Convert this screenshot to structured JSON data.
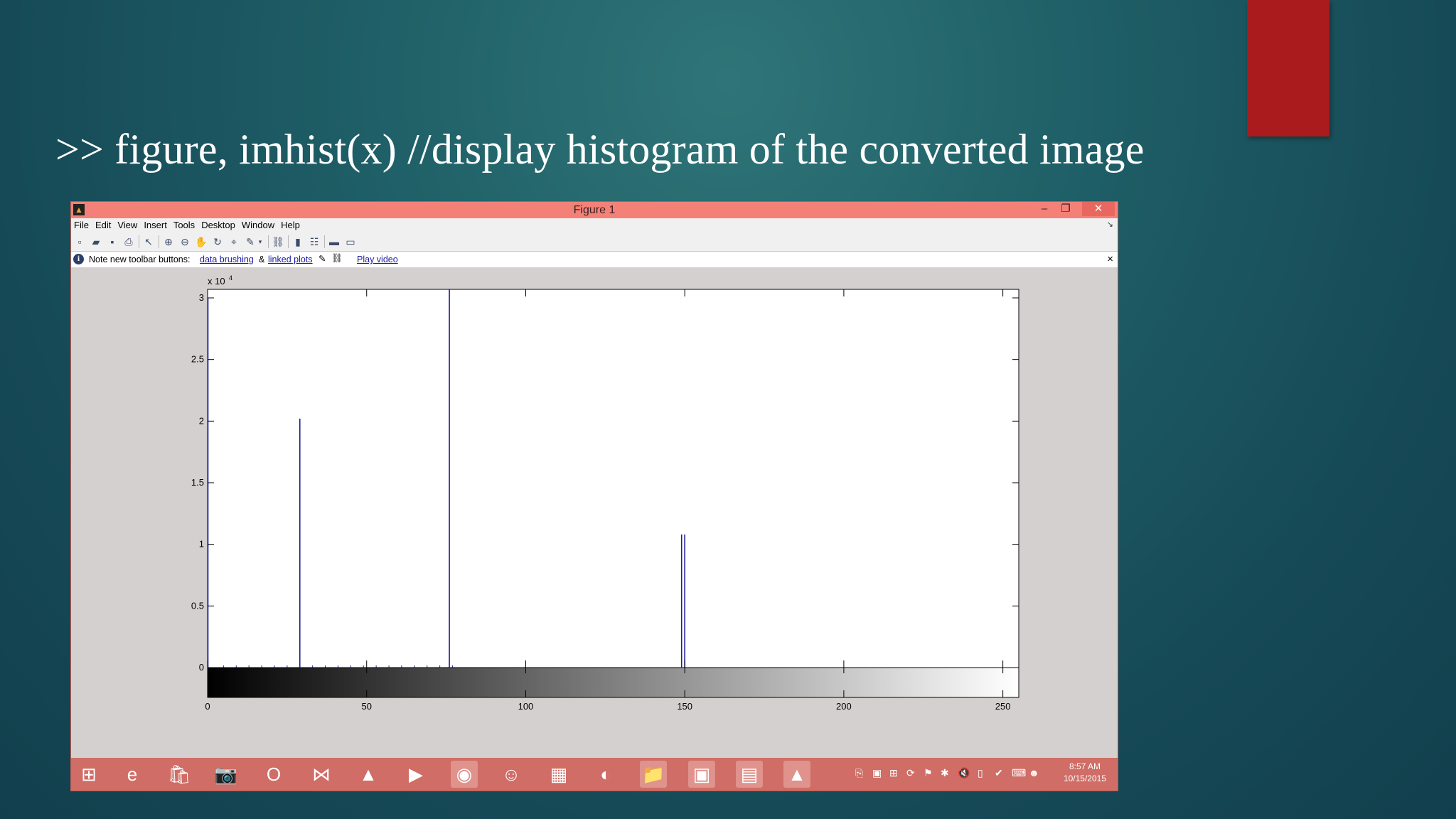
{
  "slide": {
    "title": ">> figure, imhist(x) //display histogram of the converted image"
  },
  "window": {
    "title": "Figure 1",
    "minimize_icon": "minimize-icon",
    "maximize_icon": "restore-icon",
    "close_icon": "close-icon"
  },
  "menu": {
    "items": [
      "File",
      "Edit",
      "View",
      "Insert",
      "Tools",
      "Desktop",
      "Window",
      "Help"
    ]
  },
  "toolbar": {
    "icons": [
      "new-figure-icon",
      "open-file-icon",
      "save-icon",
      "print-icon",
      "edit-plot-icon",
      "zoom-in-icon",
      "zoom-out-icon",
      "pan-icon",
      "rotate-3d-icon",
      "data-cursor-icon",
      "brush-icon",
      "link-plot-icon",
      "colorbar-icon",
      "legend-icon",
      "hide-plot-tools-icon",
      "show-plot-tools-icon"
    ]
  },
  "infobar": {
    "prefix": "Note new toolbar buttons:",
    "link1": "data brushing",
    "amp": "&",
    "link2": "linked plots",
    "link3": "Play video",
    "close": "×"
  },
  "chart_data": {
    "type": "bar",
    "title": "",
    "xlabel": "",
    "ylabel": "",
    "xlim": [
      0,
      255
    ],
    "ylim": [
      0,
      30000
    ],
    "y_exponent_label": "x 10",
    "y_exponent_power": "4",
    "xticks": [
      "0",
      "50",
      "100",
      "150",
      "200",
      "250"
    ],
    "xtick_values": [
      0,
      50,
      100,
      150,
      200,
      250
    ],
    "yticks": [
      "0",
      "0.5",
      "1",
      "1.5",
      "2",
      "2.5",
      "3"
    ],
    "ytick_values": [
      0,
      5000,
      10000,
      15000,
      20000,
      25000,
      30000
    ],
    "bins": [
      0,
      29,
      76,
      149,
      150
    ],
    "counts": [
      30000,
      20200,
      31000,
      10800,
      10800
    ],
    "series_color": "#1f1f8f",
    "colorbar": "grayscale"
  },
  "taskbar": {
    "apps": [
      "windows-start-icon",
      "internet-explorer-icon",
      "store-icon",
      "camera-icon",
      "opera-icon",
      "visual-studio-icon",
      "vlc-icon",
      "media-player-icon",
      "chrome-icon",
      "uc-browser-icon",
      "apps-grid-icon",
      "photo-app-icon",
      "file-explorer-icon",
      "powerpoint-icon",
      "winrar-icon",
      "matlab-icon"
    ],
    "time": "8:57 AM",
    "date": "10/15/2015"
  },
  "colors": {
    "accent_red": "#a91b1d",
    "titlebar": "#f48178",
    "taskbar": "#cf6d66",
    "plot_line": "#1f1f8f"
  }
}
